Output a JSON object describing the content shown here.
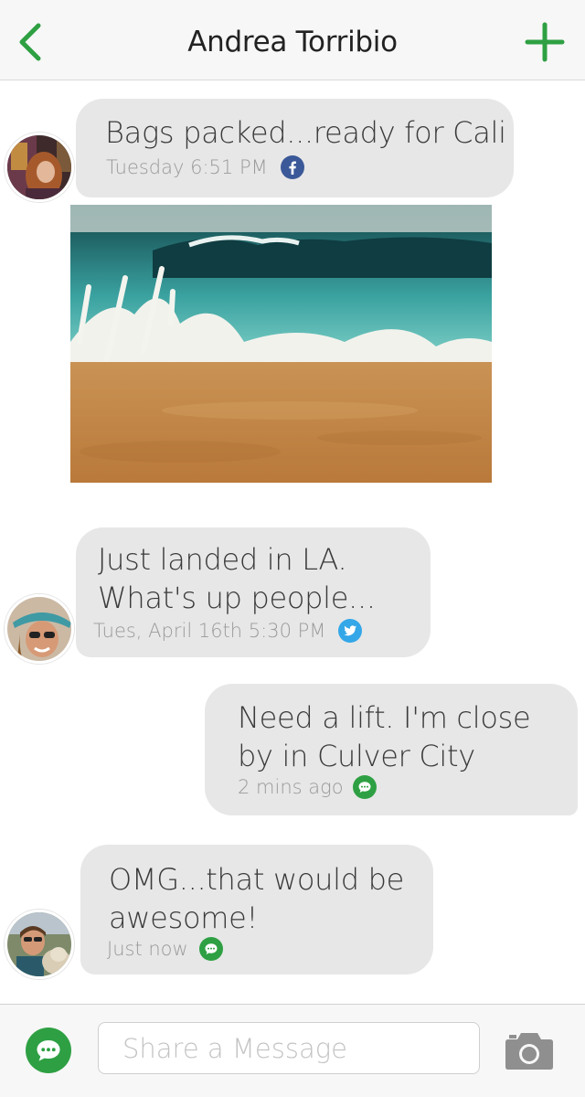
{
  "header": {
    "title": "Andrea Torribio",
    "back_icon": "chevron-left-icon",
    "add_icon": "plus-icon",
    "accent_color": "#2ea043"
  },
  "messages": [
    {
      "direction": "incoming",
      "text": "Bags packed...ready for Cali",
      "time": "Tuesday 6:51 PM",
      "source_icon": "facebook-icon",
      "source_color": "#3b5998"
    },
    {
      "direction": "incoming",
      "type": "photo",
      "subject": "ocean wave on sandy beach"
    },
    {
      "direction": "incoming",
      "text_line1": "Just landed in LA.",
      "text_line2": "What's up people...",
      "time": "Tues, April 16th 5:30 PM",
      "source_icon": "twitter-icon",
      "source_color": "#33a7e8"
    },
    {
      "direction": "outgoing",
      "text_line1": "Need a lift. I'm close",
      "text_line2": "by in Culver City",
      "time": "2 mins ago",
      "source_icon": "message-icon",
      "source_color": "#2ea043"
    },
    {
      "direction": "incoming",
      "text_line1": "OMG...that would be",
      "text_line2": "awesome!",
      "time": "Just now",
      "source_icon": "message-icon",
      "source_color": "#2ea043"
    }
  ],
  "compose": {
    "placeholder": "Share a Message",
    "compose_icon": "message-icon",
    "camera_icon": "camera-icon"
  }
}
